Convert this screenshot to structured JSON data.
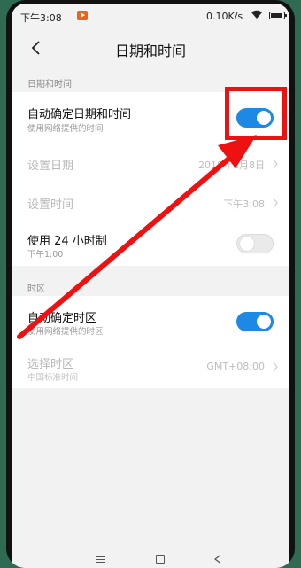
{
  "status_bar": {
    "time": "下午3:08",
    "network_speed": "0.10K/s"
  },
  "header": {
    "title": "日期和时间",
    "back_icon": "chevron-left-icon"
  },
  "sections": {
    "datetime": {
      "label": "日期和时间",
      "auto_datetime": {
        "title": "自动确定日期和时间",
        "subtitle": "使用网络提供的时间",
        "enabled": true
      },
      "set_date": {
        "title": "设置日期",
        "value": "2018年1月8日"
      },
      "set_time": {
        "title": "设置时间",
        "value": "下午3:08"
      },
      "use_24h": {
        "title": "使用 24 小时制",
        "subtitle": "下午1:00",
        "enabled": false
      }
    },
    "timezone": {
      "label": "时区",
      "auto_timezone": {
        "title": "自动确定时区",
        "subtitle": "使用网络提供的时区",
        "enabled": true
      },
      "select_timezone": {
        "title": "选择时区",
        "subtitle": "中国标准时间",
        "value": "GMT+08:00"
      }
    }
  },
  "colors": {
    "accent": "#1e88e5",
    "annotation": "#e11111",
    "background": "#f2f2f2"
  },
  "annotation": {
    "type": "arrow-and-box",
    "target": "auto-datetime-toggle"
  }
}
